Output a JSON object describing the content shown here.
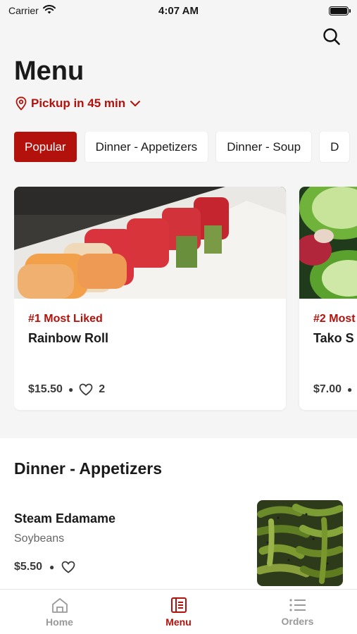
{
  "status_bar": {
    "carrier": "Carrier",
    "time": "4:07 AM"
  },
  "header": {
    "title": "Menu",
    "pickup": "Pickup in 45 min"
  },
  "categories": [
    {
      "label": "Popular",
      "active": true
    },
    {
      "label": "Dinner - Appetizers",
      "active": false
    },
    {
      "label": "Dinner - Soup",
      "active": false
    },
    {
      "label": "D",
      "active": false
    }
  ],
  "featured": [
    {
      "rank": "#1 Most Liked",
      "name": "Rainbow Roll",
      "price": "$15.50",
      "likes": "2"
    },
    {
      "rank": "#2 Most",
      "name": "Tako S",
      "price": "$7.00",
      "likes": ""
    }
  ],
  "section": {
    "title": "Dinner - Appetizers",
    "items": [
      {
        "name": "Steam Edamame",
        "description": "Soybeans",
        "price": "$5.50"
      }
    ]
  },
  "tabs": [
    {
      "label": "Home",
      "icon": "home-icon",
      "active": false
    },
    {
      "label": "Menu",
      "icon": "menu-book-icon",
      "active": true
    },
    {
      "label": "Orders",
      "icon": "list-icon",
      "active": false
    }
  ],
  "colors": {
    "accent": "#b3110b",
    "background": "#f5f5f5",
    "surface": "#ffffff"
  }
}
